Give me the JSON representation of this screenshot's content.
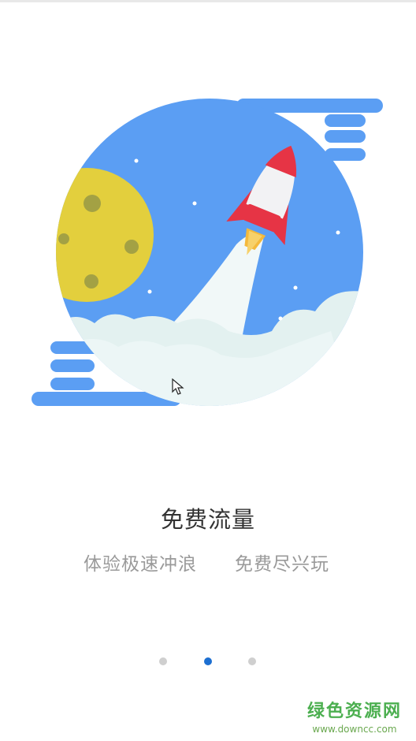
{
  "onboarding": {
    "title": "免费流量",
    "subtitle_left": "体验极速冲浪",
    "subtitle_right": "免费尽兴玩",
    "page_indicator": {
      "total": 3,
      "current": 2
    }
  },
  "watermark": {
    "name": "绿色资源网",
    "url": "www.downcc.com"
  },
  "colors": {
    "sky": "#5b9ef3",
    "moon": "#e3cf3d",
    "rocket_red": "#e63445",
    "cloud": "#e3f1f0",
    "active_dot": "#1d6fd1",
    "inactive_dot": "#cfcfcf"
  },
  "icons": {
    "illustration": "rocket-launch-illustration",
    "cursor": "mouse-pointer-icon"
  }
}
